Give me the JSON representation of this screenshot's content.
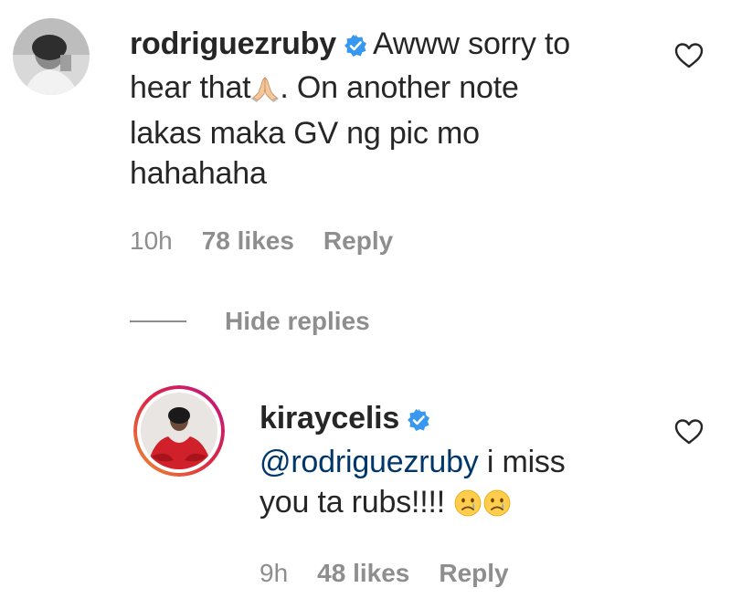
{
  "comment1": {
    "username": "rodriguezruby",
    "text_line1": "Awww sorry to",
    "text_line2a": "hear that",
    "text_line2b": ". On another note",
    "text_line3": "lakas maka GV ng pic mo",
    "text_line4": "hahahaha",
    "time": "10h",
    "likes": "78 likes",
    "reply_label": "Reply",
    "emoji_icon": "folded-hands-icon",
    "like_icon": "heart-outline-icon"
  },
  "replies_toggle": {
    "label": "Hide replies"
  },
  "comment2": {
    "username": "kiraycelis",
    "mention": "@rodriguezruby",
    "text_line1_rest": " i miss",
    "text_line2": "you ta rubs!!!!",
    "time": "9h",
    "likes": "48 likes",
    "reply_label": "Reply",
    "emoji_icon": "crying-face-icon",
    "like_icon": "heart-outline-icon"
  },
  "colors": {
    "text": "#262626",
    "secondary": "#8e8e8e",
    "mention": "#00376b",
    "verified": "#3897f0",
    "story_ring_start": "#f09433",
    "story_ring_end": "#bc1888"
  }
}
